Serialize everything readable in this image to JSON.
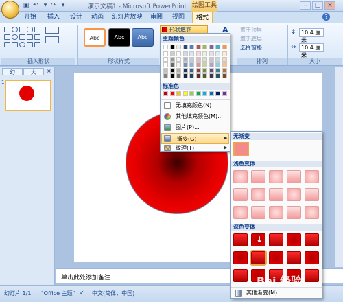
{
  "window": {
    "title": "演示文稿1 - Microsoft PowerPoint",
    "context_tab": "绘图工具",
    "controls": [
      "–",
      "□",
      "×"
    ]
  },
  "tabs": [
    {
      "label": "开始"
    },
    {
      "label": "插入"
    },
    {
      "label": "设计"
    },
    {
      "label": "动画"
    },
    {
      "label": "幻灯片放映"
    },
    {
      "label": "审阅"
    },
    {
      "label": "视图"
    },
    {
      "label": "格式",
      "active": true
    }
  ],
  "ribbon": {
    "groups": {
      "insert_shapes": "插入形状",
      "shape_styles": "形状样式",
      "arrange": "排列",
      "size": "大小"
    },
    "style_samples": [
      "Abc",
      "Abc",
      "Abc"
    ],
    "shape_fill": "形状填充",
    "arrange_items": [
      "置于顶层",
      "置于底层",
      "选择窗格"
    ],
    "size": {
      "height": "10.4 厘米",
      "width": "10.4 厘米"
    }
  },
  "left_panel": {
    "tabs": [
      "幻",
      "大"
    ],
    "slide_number": "1"
  },
  "notes_placeholder": "单击此处添加备注",
  "status": {
    "slide": "幻灯片 1/1",
    "theme": "\"Office 主题\"",
    "language": "中文(简体，中国)"
  },
  "fill_menu": {
    "theme_colors_header": "主题颜色",
    "standard_colors_header": "标准色",
    "theme_colors": [
      [
        "#ffffff",
        "#000000",
        "#eeece1",
        "#1f497d",
        "#4f81bd",
        "#c0504d",
        "#9bbb59",
        "#8064a2",
        "#4bacc6",
        "#f79646"
      ]
    ],
    "standard_colors": [
      "#c00000",
      "#ff0000",
      "#ffc000",
      "#ffff00",
      "#92d050",
      "#00b050",
      "#00b0f0",
      "#0070c0",
      "#002060",
      "#7030a0"
    ],
    "items": [
      {
        "label": "无填充颜色(N)",
        "icon": "no-fill-icon"
      },
      {
        "label": "其他填充颜色(M)...",
        "icon": "palette-icon"
      },
      {
        "label": "图片(P)...",
        "icon": "picture-icon"
      },
      {
        "label": "渐变(G)",
        "icon": "gradient-icon",
        "highlighted": true,
        "submenu": true
      },
      {
        "label": "纹理(T)",
        "icon": "texture-icon",
        "submenu": true
      }
    ]
  },
  "gradient_submenu": {
    "no_gradient_header": "无渐变",
    "light_header": "浅色变体",
    "dark_header": "深色变体",
    "more_label": "其他渐变(M)...",
    "selected_dark_index": 6
  },
  "watermark": "Bai 经验"
}
